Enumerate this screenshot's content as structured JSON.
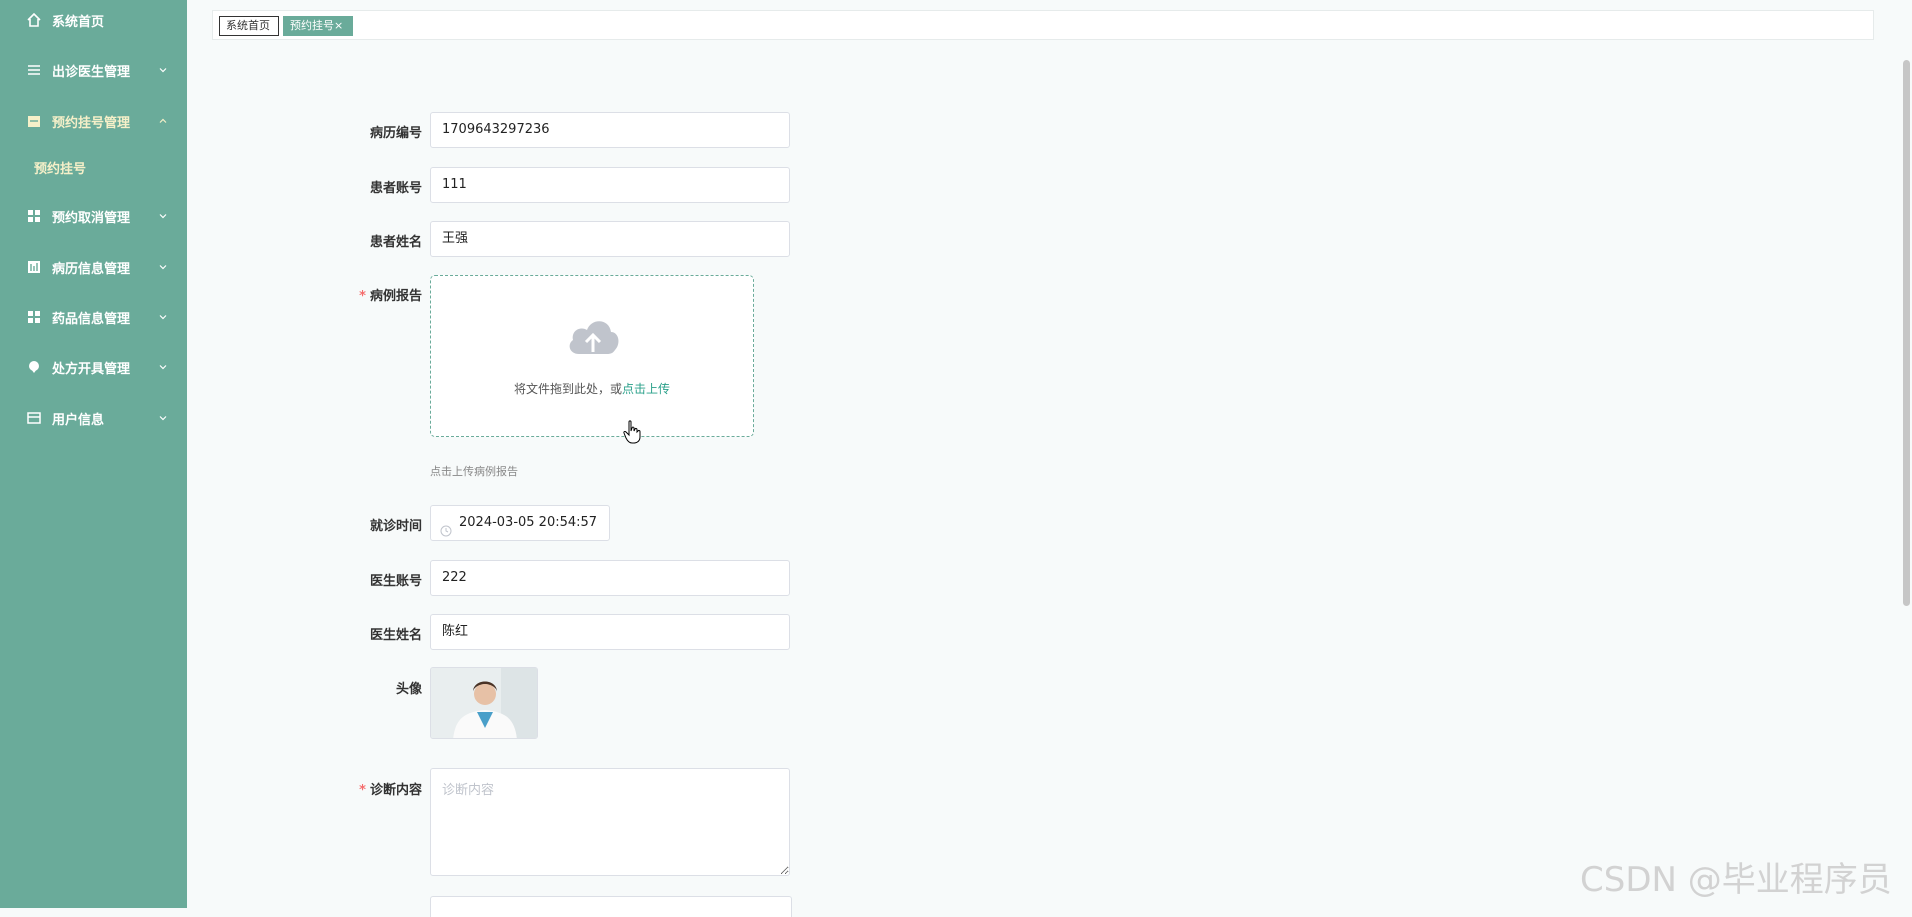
{
  "sidebar": {
    "items": [
      {
        "label": "系统首页",
        "icon": "home-icon"
      },
      {
        "label": "出诊医生管理",
        "icon": "list-icon"
      },
      {
        "label": "预约挂号管理",
        "icon": "calendar-icon"
      },
      {
        "label": "预约取消管理",
        "icon": "grid-icon"
      },
      {
        "label": "病历信息管理",
        "icon": "chart-icon"
      },
      {
        "label": "药品信息管理",
        "icon": "grid-icon"
      },
      {
        "label": "处方开具管理",
        "icon": "pin-icon"
      },
      {
        "label": "用户信息",
        "icon": "card-icon"
      }
    ],
    "sub_item": "预约挂号"
  },
  "tags": {
    "home": "系统首页",
    "current": "预约挂号",
    "close": "×"
  },
  "form": {
    "record_no": {
      "label": "病历编号",
      "value": "1709643297236"
    },
    "patient_account": {
      "label": "患者账号",
      "value": "111"
    },
    "patient_name": {
      "label": "患者姓名",
      "value": "王强"
    },
    "report": {
      "label": "病例报告",
      "required": "*",
      "drop_text": "将文件拖到此处，或",
      "click_text": "点击上传",
      "tip": "点击上传病例报告"
    },
    "visit_time": {
      "label": "就诊时间",
      "value": "2024-03-05 20:54:57"
    },
    "doctor_account": {
      "label": "医生账号",
      "value": "222"
    },
    "doctor_name": {
      "label": "医生姓名",
      "value": "陈红"
    },
    "avatar": {
      "label": "头像"
    },
    "diagnosis": {
      "label": "诊断内容",
      "required": "*",
      "placeholder": "诊断内容"
    }
  },
  "watermark": "CSDN @毕业程序员",
  "colors": {
    "sidebar": "#6aab9a",
    "accent": "#2aa08a",
    "active_text": "#f6f0c9",
    "required": "#f56c6c"
  }
}
